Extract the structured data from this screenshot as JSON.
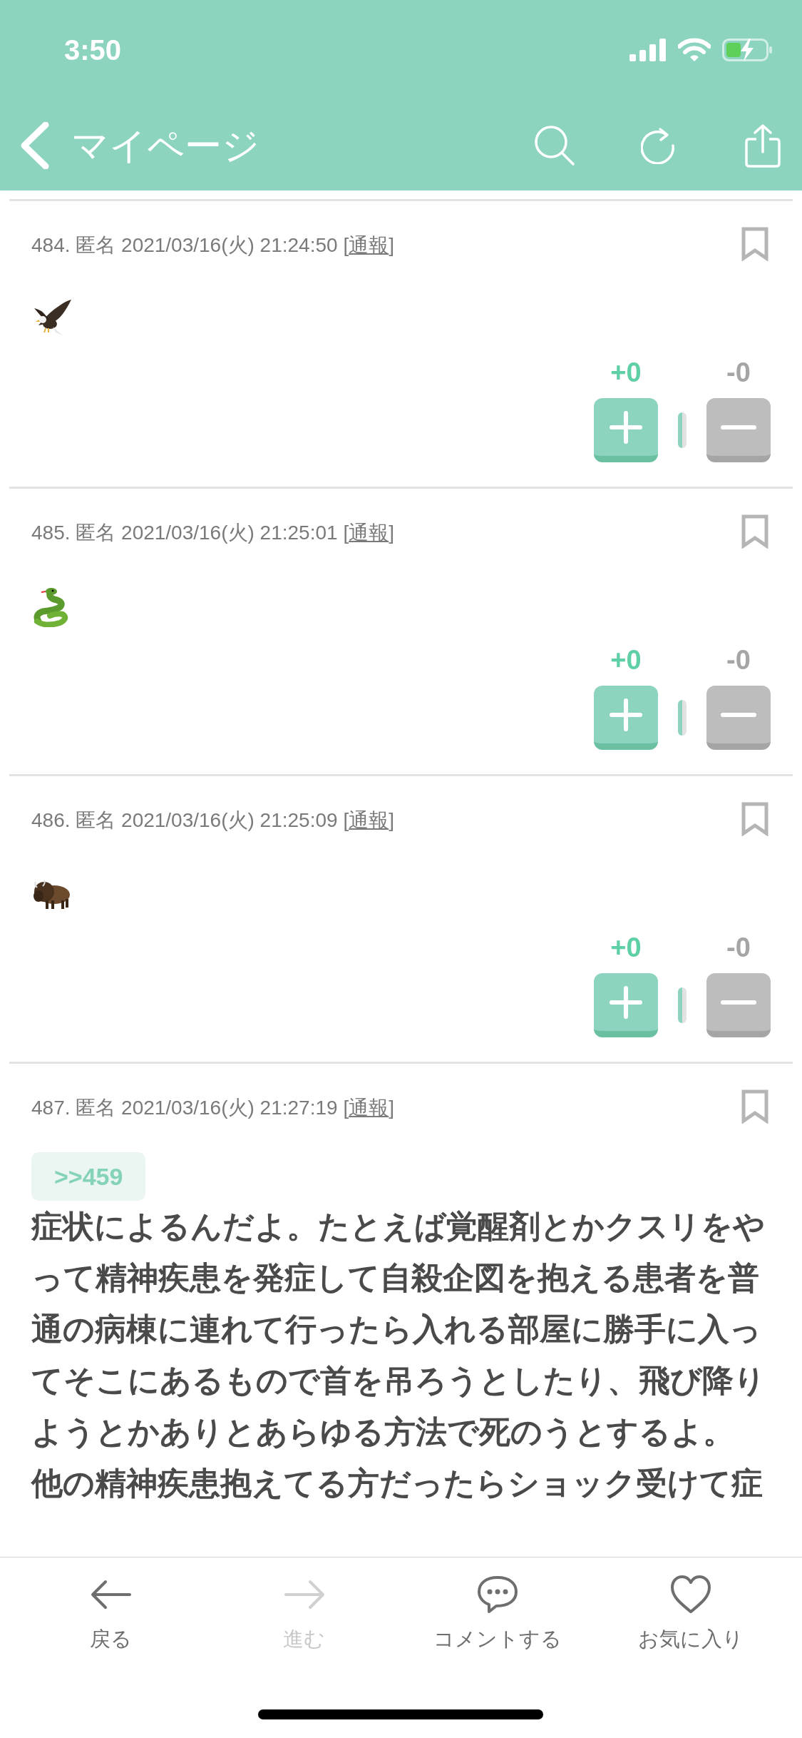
{
  "status_bar": {
    "time": "3:50",
    "battery_charging": true
  },
  "nav_bar": {
    "title": "マイページ"
  },
  "posts": [
    {
      "meta": "484. 匿名 2021/03/16(火) 21:24:50",
      "report_open": "[",
      "report": "通報",
      "report_close": "]",
      "bookmarked": false,
      "body": {
        "kind": "eagle"
      },
      "votes": {
        "plus": "+0",
        "minus": "-0"
      }
    },
    {
      "meta": "485. 匿名 2021/03/16(火) 21:25:01",
      "report_open": "[",
      "report": "通報",
      "report_close": "]",
      "bookmarked": false,
      "body": {
        "kind": "snake"
      },
      "votes": {
        "plus": "+0",
        "minus": "-0"
      }
    },
    {
      "meta": "486. 匿名 2021/03/16(火) 21:25:09",
      "report_open": "[",
      "report": "通報",
      "report_close": "]",
      "bookmarked": false,
      "body": {
        "kind": "bison"
      },
      "votes": {
        "plus": "+0",
        "minus": "-0"
      }
    },
    {
      "meta": "487. 匿名 2021/03/16(火) 21:27:19",
      "report_open": "[",
      "report": "通報",
      "report_close": "]",
      "bookmarked": false,
      "body": {
        "kind": "text",
        "reply_to": ">>459",
        "paragraphs": [
          "症状によるんだよ。たとえば覚醒剤とかクスリをやって精神疾患を発症して自殺企図を抱える患者を普通の病棟に連れて行ったら入れる部屋に勝手に入ってそこにあるもので首を吊ろうとしたり、飛び降りようとかありとあらゆる方法で死のうとするよ。",
          "他の精神疾患抱えてる方だったらショック受けて症"
        ]
      }
    }
  ],
  "tab_bar": [
    {
      "kind": "back",
      "label": "戻る",
      "disabled": false
    },
    {
      "kind": "forward",
      "label": "進む",
      "disabled": true
    },
    {
      "kind": "comment",
      "label": "コメントする",
      "disabled": false
    },
    {
      "kind": "favorite",
      "label": "お気に入り",
      "disabled": false
    }
  ]
}
